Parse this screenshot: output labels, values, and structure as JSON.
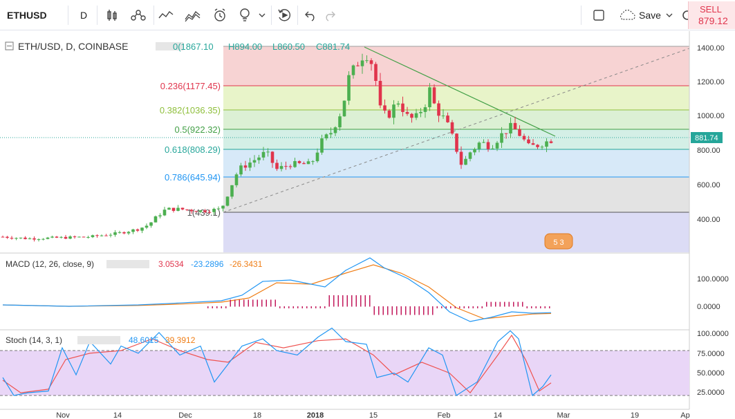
{
  "toolbar": {
    "symbol": "ETHUSD",
    "interval": "D",
    "save_label": "Save",
    "sell_label": "SELL",
    "sell_price": "879.12",
    "icons": [
      "bar-style-icon",
      "indicators-icon",
      "line-tool-icon",
      "compare-icon",
      "alert-icon",
      "ideas-icon",
      "chevron-down-icon",
      "replay-icon",
      "undo-icon",
      "redo-icon",
      "fullscreen-icon",
      "cloud-save-icon",
      "settings-icon"
    ]
  },
  "main_pane": {
    "legend_symbol": "ETH/USD, D, COINBASE",
    "ohlc": {
      "O": "0(1867.10",
      "H": "H894.00",
      "L": "L860.50",
      "C": "C881.74"
    },
    "last_price_label": "881.74",
    "price_axis": [
      "1400.00",
      "1200.00",
      "1000.00",
      "800.00",
      "600.00",
      "400.00"
    ],
    "fib_levels": [
      {
        "label": "0.236(1177.45)",
        "value": 1177.45,
        "color": "#e0344c"
      },
      {
        "label": "0.382(1036.35)",
        "value": 1036.35,
        "color": "#8fbf3c"
      },
      {
        "label": "0.5(922.32)",
        "value": 922.32,
        "color": "#43a047"
      },
      {
        "label": "0.618(808.29)",
        "value": 808.29,
        "color": "#26a69a"
      },
      {
        "label": "0.786(645.94)",
        "value": 645.94,
        "color": "#2196f3"
      },
      {
        "label": "1(439.1)",
        "value": 439.1,
        "color": "#555555"
      }
    ],
    "badge_text": "5 3"
  },
  "macd_pane": {
    "legend_name": "MACD (12, 26, close, 9)",
    "values": [
      "3.0534",
      "-23.2896",
      "-26.3431"
    ],
    "value_colors": [
      "#e0344c",
      "#2196f3",
      "#ef7d15"
    ],
    "axis": [
      "100.0000",
      "0.0000"
    ]
  },
  "stoch_pane": {
    "legend_name": "Stoch (14, 3, 1)",
    "values": [
      "48.6015",
      "39.3912"
    ],
    "value_colors": [
      "#2196f3",
      "#ef7d15"
    ],
    "axis": [
      "100.0000",
      "75.0000",
      "50.0000",
      "25.0000"
    ]
  },
  "time_axis": [
    "Nov",
    "14",
    "Dec",
    "18",
    "2018",
    "15",
    "Feb",
    "14",
    "Mar",
    "19",
    "Ap"
  ]
}
